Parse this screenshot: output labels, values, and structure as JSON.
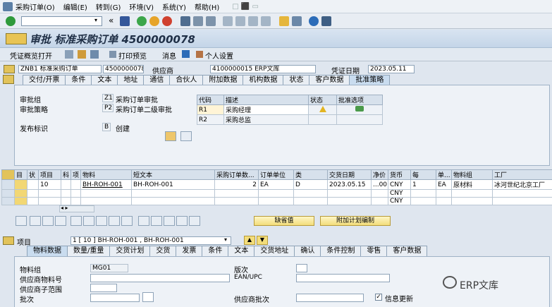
{
  "menu": [
    "采购订单(O)",
    "编辑(E)",
    "转到(G)",
    "环境(V)",
    "系统(Y)",
    "帮助(H)"
  ],
  "toolbar": {
    "back_glyph": "«"
  },
  "title": "审批 标准采购订单 4500000078",
  "app_toolbar": {
    "doc_overview": "凭证概览打开",
    "print_preview": "打印预览",
    "messages": "消息",
    "personal_settings": "个人设置"
  },
  "header": {
    "doc_type": "ZNB1 标准采购订单",
    "po_number": "4500000078",
    "vendor_label": "供应商",
    "vendor_value": "4100000015 ERP文库",
    "doc_date_label": "凭证日期",
    "doc_date": "2023.05.11"
  },
  "header_tabs": [
    "交付/开票",
    "条件",
    "文本",
    "地址",
    "通信",
    "合伙人",
    "附加数据",
    "机构数据",
    "状态",
    "客户数据",
    "批准策略"
  ],
  "release": {
    "group_label": "审批组",
    "group_code": "Z1",
    "group_text": "采购订单审批",
    "strategy_label": "审批策略",
    "strategy_code": "P2",
    "strategy_text": "采购订单二级审批",
    "indicator_label": "发布标识",
    "indicator_code": "B",
    "indicator_text": "创建"
  },
  "release_table": {
    "headers": [
      "代码",
      "描述",
      "状态",
      "批准选项"
    ],
    "rows": [
      {
        "code": "R1",
        "desc": "采购经理"
      },
      {
        "code": "R2",
        "desc": "采购总监"
      }
    ]
  },
  "items": {
    "headers": [
      "",
      "",
      " 状",
      "项目",
      "科",
      "项",
      "物料",
      "短文本",
      "采购订单数...",
      "订单单位",
      "类",
      "交货日期",
      "净价",
      "货币",
      "每",
      "单...",
      "物料组",
      "工厂"
    ],
    "row1": {
      "item": "10",
      "material": "BH-ROH-001",
      "short_text": "BH-ROH-001",
      "qty": "2",
      "unit": "EA",
      "cat": "D",
      "date": "2023.05.15",
      "price": "...00",
      "currency": "CNY",
      "per": "1",
      "unit2": "EA",
      "matgroup": "原材料",
      "plant": "冰河世纪北京工厂"
    },
    "row2": {
      "currency": "CNY"
    },
    "row3": {
      "currency": "CNY"
    }
  },
  "buttons": {
    "default_values": "缺省值",
    "addl_planning": "附加计划编制"
  },
  "item_detail": {
    "label": "项目",
    "selector": "1 [ 10 ] BH-ROH-001 , BH-ROH-001"
  },
  "item_tabs": [
    "物料数据",
    "数量/重量",
    "交货计划",
    "交货",
    "发票",
    "条件",
    "文本",
    "交货地址",
    "确认",
    "条件控制",
    "零售",
    "客户数据"
  ],
  "material_data": {
    "matgroup_label": "物料组",
    "matgroup_value": "MG01",
    "batch_label": "版次",
    "vendor_mat_label": "供应商物料号",
    "ean_label": "EAN/UPC",
    "vendor_subrange_label": "供应商子范围",
    "batch2_label": "批次",
    "vendor_batch_label": "供应商批次",
    "info_update_label": "信息更新",
    "info_update_checked": true
  },
  "watermark": "ERP文库"
}
